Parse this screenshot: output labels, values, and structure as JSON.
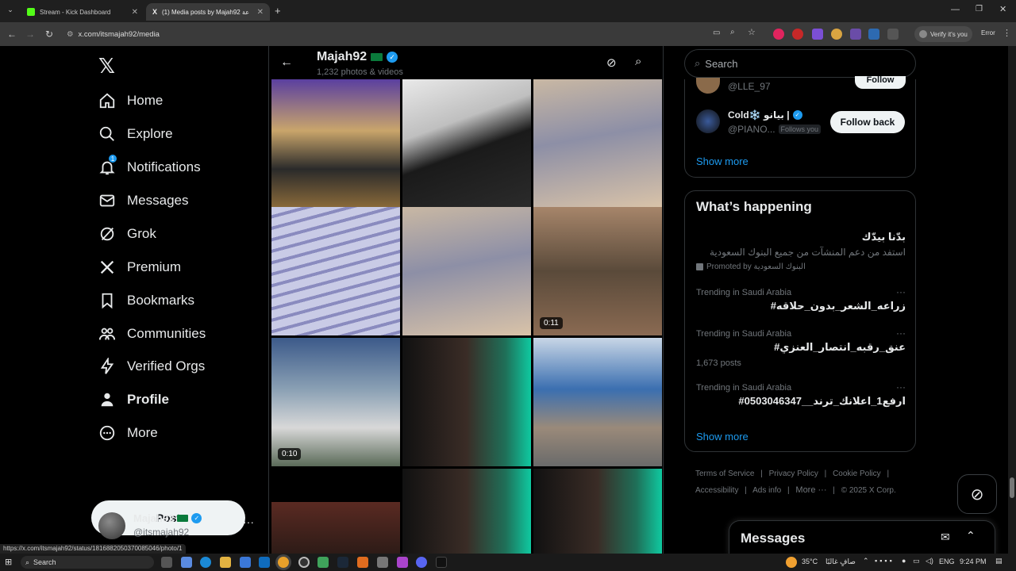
{
  "browser": {
    "tabs": [
      {
        "title": "Stream - Kick Dashboard",
        "active": false
      },
      {
        "title": "(1) Media posts by Majah92 ساعة",
        "active": true
      }
    ],
    "url": "x.com/itsmajah92/media",
    "profile_status": "Verify it's you",
    "error_label": "Error",
    "status_url": "https://x.com/itsmajah92/status/1816882050370085046/photo/1"
  },
  "sidebar": {
    "items": [
      {
        "label": "Home",
        "icon": "home-icon",
        "badge": null
      },
      {
        "label": "Explore",
        "icon": "search-icon",
        "badge": null
      },
      {
        "label": "Notifications",
        "icon": "bell-icon",
        "badge": "1"
      },
      {
        "label": "Messages",
        "icon": "mail-icon",
        "badge": null
      },
      {
        "label": "Grok",
        "icon": "grok-icon",
        "badge": null
      },
      {
        "label": "Premium",
        "icon": "x-logo-icon",
        "badge": null
      },
      {
        "label": "Bookmarks",
        "icon": "bookmark-icon",
        "badge": null
      },
      {
        "label": "Communities",
        "icon": "people-icon",
        "badge": null
      },
      {
        "label": "Verified Orgs",
        "icon": "lightning-icon",
        "badge": null
      },
      {
        "label": "Profile",
        "icon": "person-icon",
        "badge": null
      },
      {
        "label": "More",
        "icon": "more-circle-icon",
        "badge": null
      }
    ],
    "post_label": "Post",
    "account": {
      "name": "Majah92",
      "handle": "@itsmajah92"
    }
  },
  "profile_header": {
    "name": "Majah92",
    "subtitle": "1,232 photos & videos"
  },
  "media": {
    "items": [
      {
        "duration": ""
      },
      {
        "duration": ""
      },
      {
        "duration": ""
      },
      {
        "duration": ""
      },
      {
        "duration": ""
      },
      {
        "duration": "0:11"
      },
      {
        "duration": "0:10"
      },
      {
        "duration": ""
      },
      {
        "duration": ""
      },
      {
        "duration": ""
      },
      {
        "duration": ""
      },
      {
        "duration": ""
      }
    ]
  },
  "right": {
    "search_placeholder": "Search",
    "who_to_follow": [
      {
        "name": "",
        "handle": "@LLE_97",
        "button": "Follow"
      },
      {
        "name": "Cold❄️ بيانو |",
        "handle": "@PIANO...",
        "follows_you": "Follows you",
        "button": "Follow back"
      }
    ],
    "show_more": "Show more",
    "whats_happening_title": "What’s happening",
    "promo": {
      "title": "بدّنا بيدّك",
      "body": "استفد من دعم المنشآت من جميع البنوك السعودية",
      "promoted": "Promoted by البنوك السعودية"
    },
    "trends": [
      {
        "context": "Trending in Saudi Arabia",
        "name": "#زراعه_الشعر_بدون_حلاقه",
        "posts": ""
      },
      {
        "context": "Trending in Saudi Arabia",
        "name": "#عنق_رقبه_انتصار_العنزي",
        "posts": "1,673 posts"
      },
      {
        "context": "Trending in Saudi Arabia",
        "name": "#ارفع1_اعلانك_ترند__0503046347",
        "posts": ""
      }
    ],
    "show_more_2": "Show more",
    "footer": {
      "terms": "Terms of Service",
      "privacy": "Privacy Policy",
      "cookie": "Cookie Policy",
      "accessibility": "Accessibility",
      "ads": "Ads info",
      "more": "More ···",
      "copyright": "© 2025 X Corp."
    },
    "messages_title": "Messages"
  },
  "taskbar": {
    "search": "Search",
    "weather": "35°C",
    "weather_text": "صافٍ غالبًا",
    "lang": "ENG",
    "time": "9:24 PM"
  },
  "colors": {
    "accent": "#1d9bf0",
    "bg": "#000000",
    "border": "#2f3336",
    "muted": "#71767b"
  }
}
